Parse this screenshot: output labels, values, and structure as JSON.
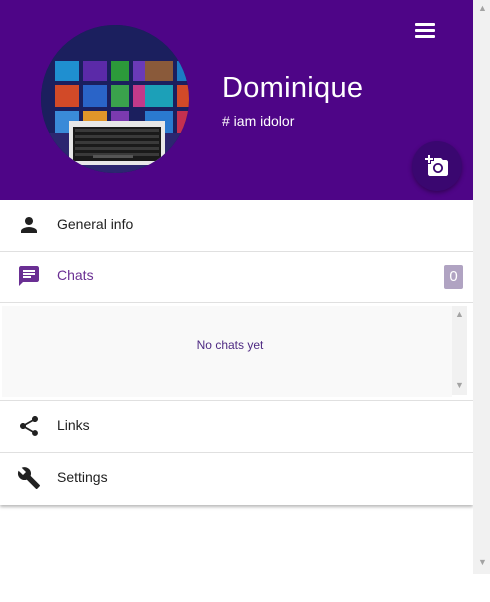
{
  "profile": {
    "name": "Dominique",
    "tagline": "# iam idolor",
    "avatar_icon": "profile-photo-windows8-keyboard",
    "camera_icon": "add-a-photo-icon"
  },
  "menu_icon": "hamburger-menu-icon",
  "nav": {
    "general_info": {
      "label": "General info",
      "icon": "person-icon"
    },
    "chats": {
      "label": "Chats",
      "icon": "chat-icon",
      "count": "0"
    },
    "links": {
      "label": "Links",
      "icon": "share-icon"
    },
    "settings": {
      "label": "Settings",
      "icon": "wrench-icon"
    }
  },
  "chats_panel": {
    "empty_text": "No chats yet"
  },
  "colors": {
    "header_bg": "#4e0587",
    "accent": "#6a2f93",
    "badge_bg": "#b0a3c2",
    "camera_button_bg": "#3a0770"
  }
}
